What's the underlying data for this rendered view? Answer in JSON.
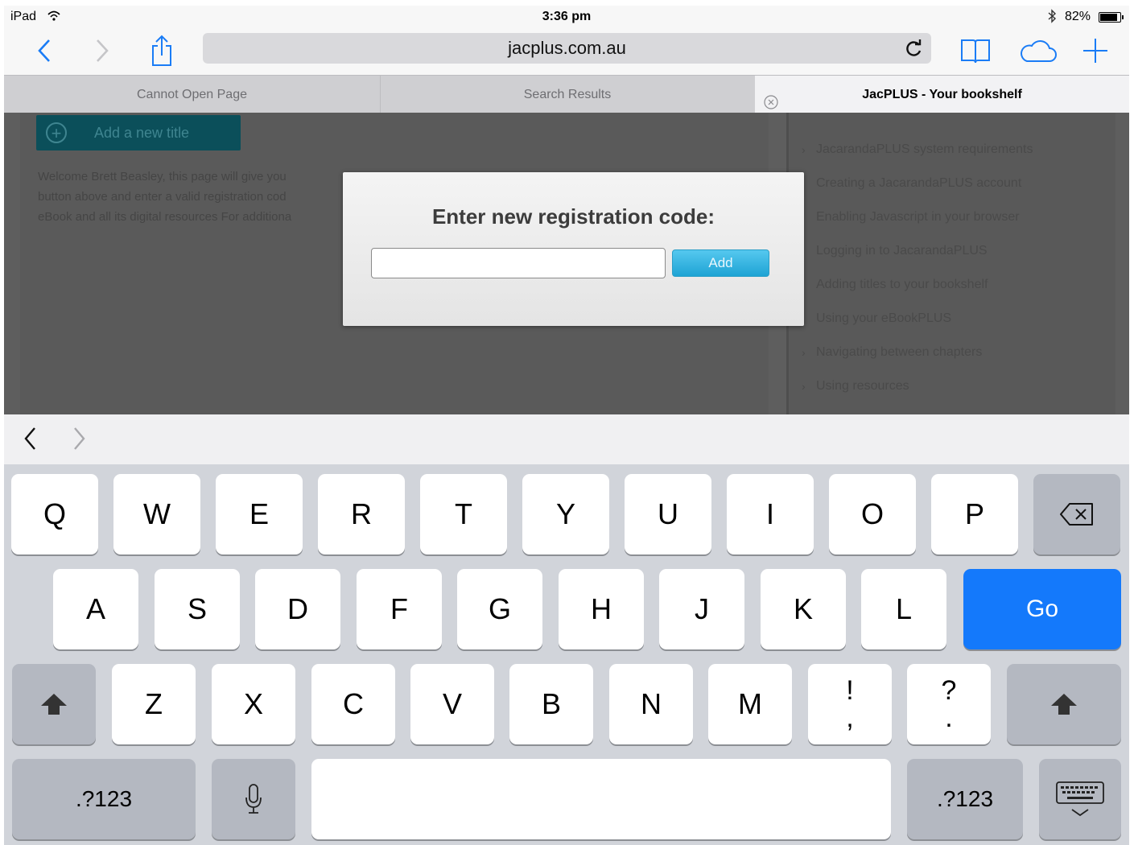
{
  "status_bar": {
    "device": "iPad",
    "time": "3:36 pm",
    "battery_percent": "82%",
    "battery_level": 0.82
  },
  "toolbar": {
    "url": "jacplus.com.au",
    "icons": [
      "back-icon",
      "forward-icon",
      "share-icon",
      "reload-icon",
      "bookmarks-icon",
      "icloud-tabs-icon",
      "new-tab-icon"
    ]
  },
  "tabs": [
    {
      "label": "Cannot Open Page"
    },
    {
      "label": "Search Results"
    },
    {
      "label": "JacPLUS - Your bookshelf"
    }
  ],
  "page": {
    "add_title_label": "Add a new title",
    "welcome_lines": [
      "Welcome Brett Beasley, this page will give you",
      "button above and enter a valid registration cod",
      "eBook and all its digital resources For additiona"
    ],
    "help_items": [
      {
        "label": "JacarandaPLUS system requirements",
        "bullet": "›"
      },
      {
        "label": "Creating a JacarandaPLUS account",
        "bullet": ""
      },
      {
        "label": "Enabling Javascript in your browser",
        "bullet": ""
      },
      {
        "label": "Logging in to JacarandaPLUS",
        "bullet": ""
      },
      {
        "label": "Adding titles to your bookshelf",
        "bullet": ""
      },
      {
        "label": "Using your eBookPLUS",
        "bullet": ""
      },
      {
        "label": "Navigating between chapters",
        "bullet": "›"
      },
      {
        "label": "Using resources",
        "bullet": "›"
      }
    ]
  },
  "modal": {
    "title": "Enter new registration code:",
    "input_value": "",
    "add_label": "Add"
  },
  "keyboard": {
    "row1": [
      "Q",
      "W",
      "E",
      "R",
      "T",
      "Y",
      "U",
      "I",
      "O",
      "P"
    ],
    "row2": [
      "A",
      "S",
      "D",
      "F",
      "G",
      "H",
      "J",
      "K",
      "L"
    ],
    "go_label": "Go",
    "row3": [
      "Z",
      "X",
      "C",
      "V",
      "B",
      "N",
      "M"
    ],
    "punct1_top": "!",
    "punct1_bottom": ",",
    "punct2_top": "?",
    "punct2_bottom": ".",
    "numbers_label": ".?123",
    "accent_color": "#1479fb"
  }
}
